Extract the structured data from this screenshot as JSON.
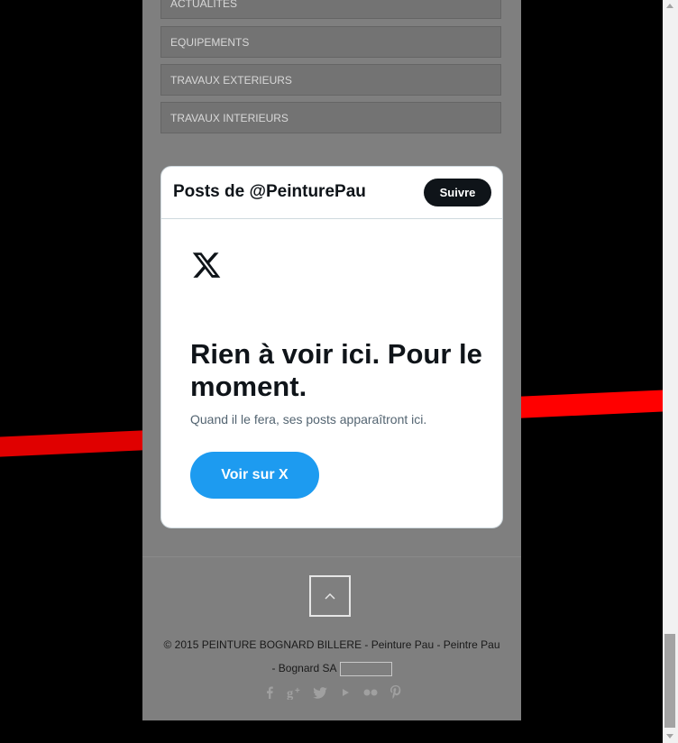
{
  "categories": [
    "ACTUALITES",
    "EQUIPEMENTS",
    "TRAVAUX EXTERIEURS",
    "TRAVAUX INTERIEURS"
  ],
  "widget": {
    "title": "Posts de @PeinturePau",
    "follow_label": "Suivre",
    "heading": "Rien à voir ici. Pour le moment.",
    "subtext": "Quand il le fera, ses posts apparaîtront ici.",
    "view_label": "Voir sur X"
  },
  "footer": {
    "copyright": "© 2015 PEINTURE BOGNARD BILLERE - Peinture Pau - Peintre Pau - Bognard SA",
    "social_icons": [
      "facebook-icon",
      "google-plus-icon",
      "twitter-icon",
      "youtube-icon",
      "flickr-icon",
      "pinterest-icon"
    ]
  },
  "colors": {
    "panel": "#7f7f7f",
    "stripe": "#ff0000",
    "view_button": "#1d9bf0",
    "follow_button": "#0f1419"
  }
}
